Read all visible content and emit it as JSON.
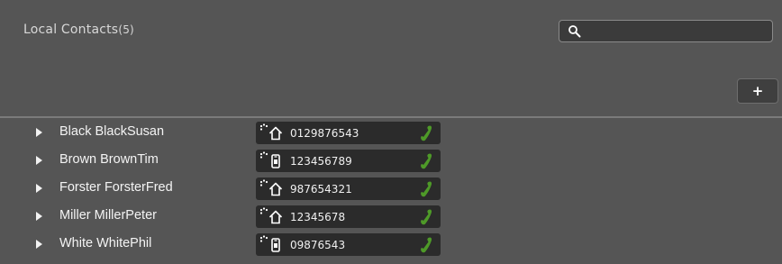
{
  "header": {
    "title": "Local Contacts",
    "count": "(5)",
    "add_label": "+"
  },
  "search": {
    "placeholder": "",
    "value": ""
  },
  "colors": {
    "background": "#555555",
    "phone_box": "#2b2b2b",
    "call_icon": "#4e9a28"
  },
  "contacts": [
    {
      "name": "Black BlackSusan",
      "number": "0129876543",
      "type": "home-icon"
    },
    {
      "name": "Brown BrownTim",
      "number": "123456789",
      "type": "mobile-icon"
    },
    {
      "name": "Forster ForsterFred",
      "number": "987654321",
      "type": "home-icon"
    },
    {
      "name": "Miller MillerPeter",
      "number": "12345678",
      "type": "home-icon"
    },
    {
      "name": "White WhitePhil",
      "number": "09876543",
      "type": "mobile-icon"
    }
  ]
}
